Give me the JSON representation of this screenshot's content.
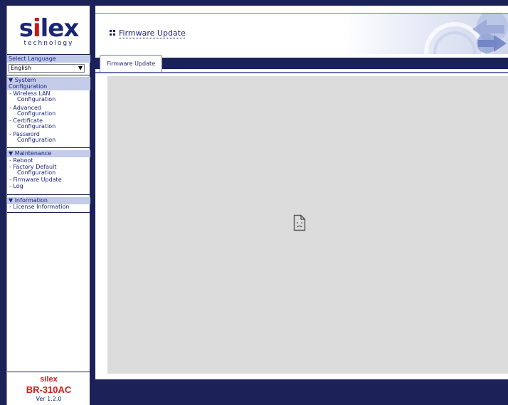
{
  "logo": {
    "word_prefix": "s",
    "word_i": "i",
    "word_suffix": "lex",
    "sub": "technology"
  },
  "language": {
    "label": "Select Language",
    "selected": "English"
  },
  "menu": {
    "system": {
      "head_line1": "▼ System",
      "head_line2": "Configuration",
      "items": [
        {
          "line1": "- Wireless LAN",
          "line2": "Configuration"
        },
        {
          "line1": "- Advanced",
          "line2": "Configuration"
        },
        {
          "line1": "- Certificate",
          "line2": "Configuration"
        },
        {
          "line1": "- Password",
          "line2": "Configuration"
        }
      ]
    },
    "maintenance": {
      "head": "▼ Maintenance",
      "items": [
        {
          "line1": "- Reboot"
        },
        {
          "line1": "- Factory Default",
          "line2": "Configuration"
        },
        {
          "line1": "- Firmware Update"
        },
        {
          "line1": "- Log"
        }
      ]
    },
    "information": {
      "head": "▼ Information",
      "items": [
        {
          "line1": "- License Information"
        }
      ]
    }
  },
  "footer": {
    "brand": "silex",
    "model": "BR-310AC",
    "version": "Ver 1.2.0"
  },
  "page": {
    "title": "Firmware Update",
    "tab_label": "Firmware Update"
  },
  "icons": {
    "broken_content": "broken-page-icon",
    "title_bullet": "grid-bullet-icon"
  },
  "colors": {
    "navy": "#1a2257",
    "menu_head_bg": "#c2cbe8",
    "brand_red": "#d41c1c",
    "content_gray": "#dcdcdc"
  }
}
